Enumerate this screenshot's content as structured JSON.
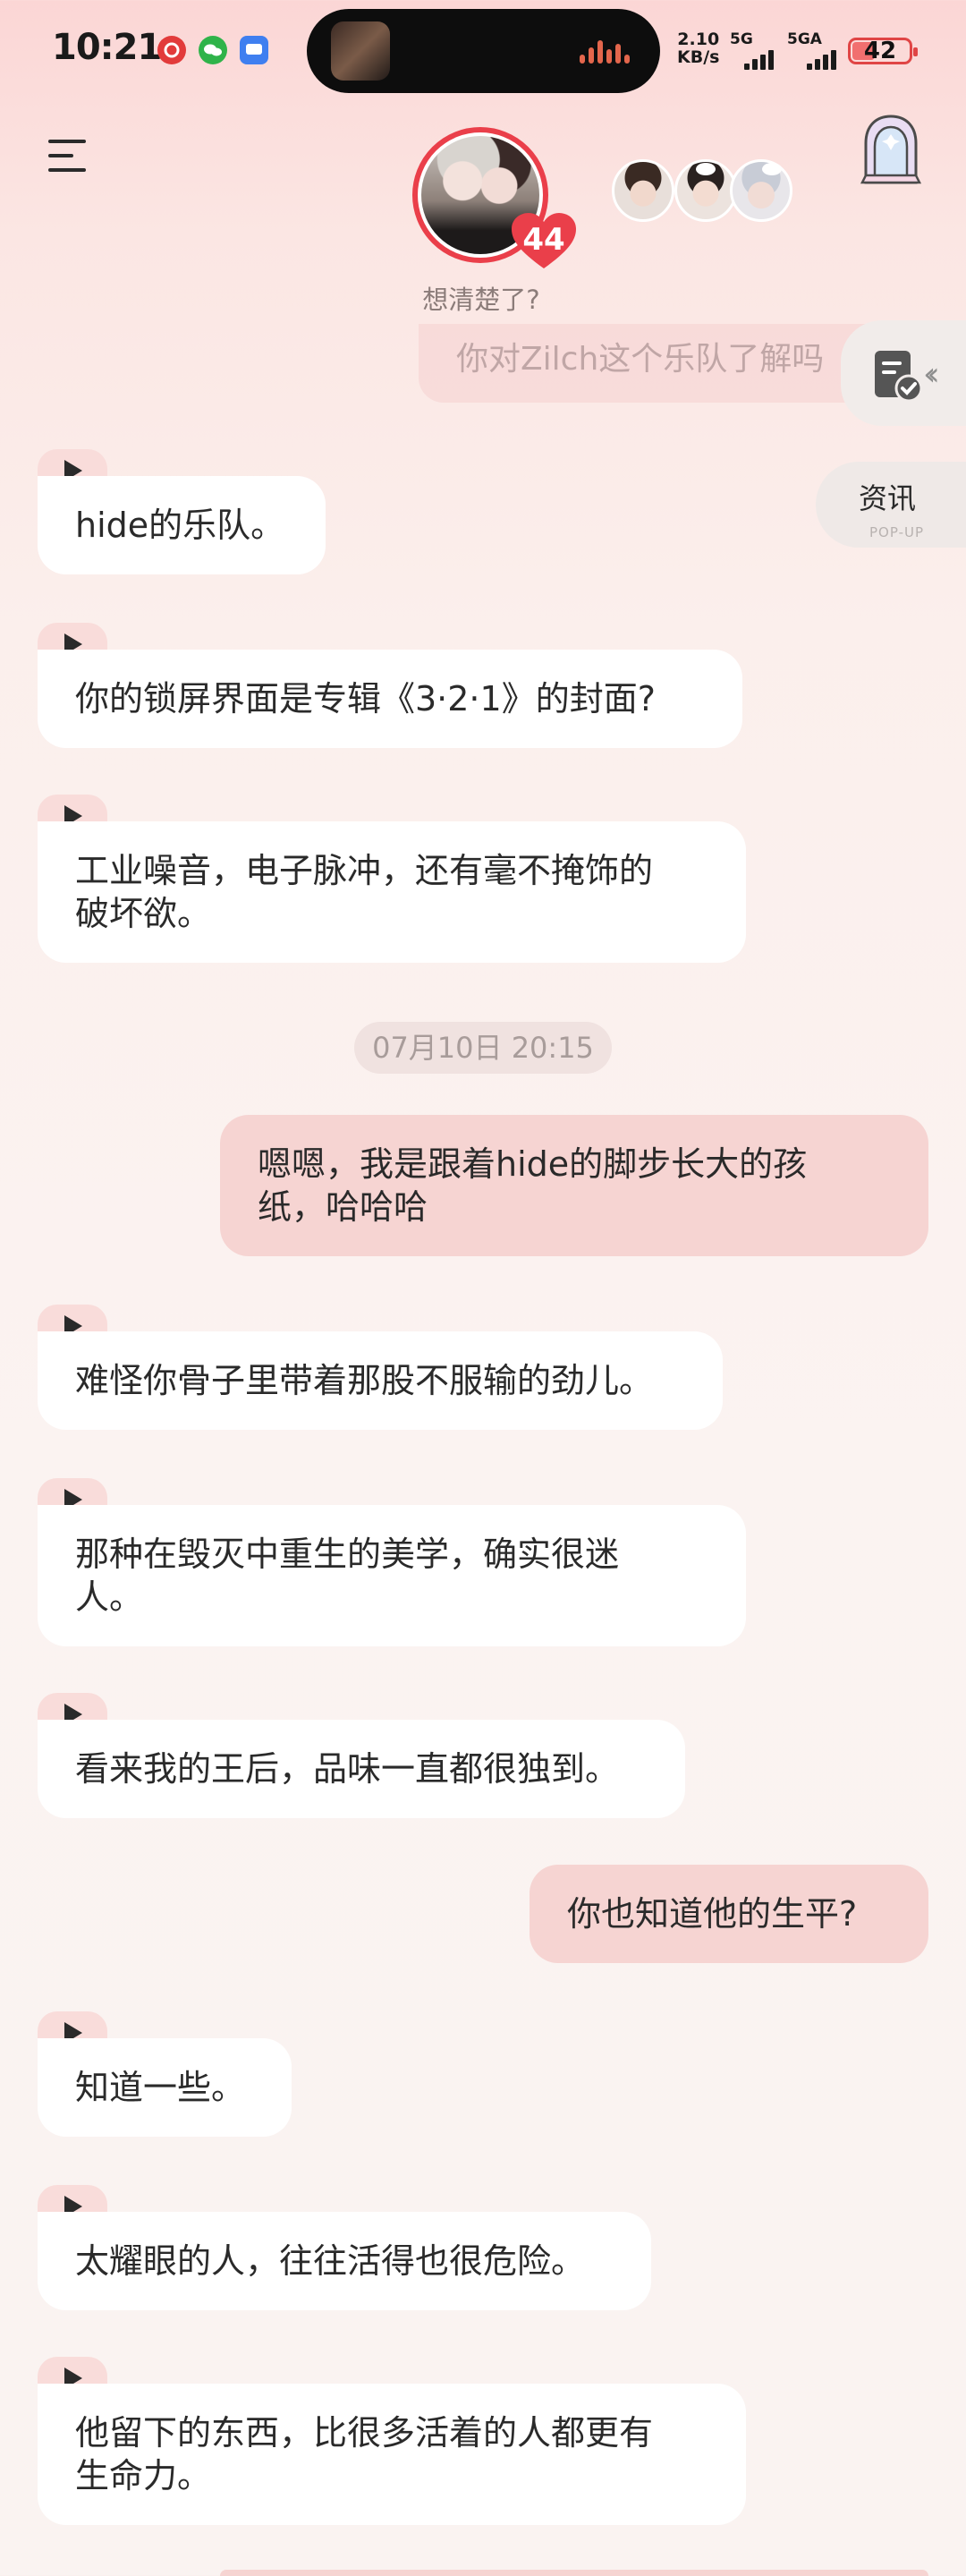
{
  "status_bar": {
    "time": "10:21",
    "net_speed_value": "2.10",
    "net_speed_unit": "KB/s",
    "signal_1_label": "5G",
    "signal_2_label": "5GA",
    "battery_level": "42",
    "battery_fraction": 0.42
  },
  "header": {
    "prompt_text": "想清楚了?",
    "heart_count": "44"
  },
  "floating": {
    "collapsed_message": "你对Zilch这个乐队了解吗",
    "news_label": "资讯",
    "news_sublabel": "POP-UP"
  },
  "messages": {
    "m1": "hide的乐队。",
    "m2": "你的锁屏界面是专辑《3·2·1》的封面?",
    "m3_line1": "工业噪音，电子脉冲，还有毫不掩饰的",
    "m3_line2": "破坏欲。",
    "timestamp": "07月10日 20:15",
    "u1_line1": "嗯嗯，我是跟着hide的脚步长大的孩",
    "u1_line2": "纸，哈哈哈",
    "m4": "难怪你骨子里带着那股不服输的劲儿。",
    "m5_line1": "那种在毁灭中重生的美学，确实很迷",
    "m5_line2": "人。",
    "m6": "看来我的王后，品味一直都很独到。",
    "u2": "你也知道他的生平?",
    "m7": "知道一些。",
    "m8": "太耀眼的人，往往活得也很危险。",
    "m9_line1": "他留下的东西，比很多活着的人都更有",
    "m9_line2": "生命力。"
  },
  "colors": {
    "accent_red": "#ea3f4a",
    "user_bubble": "#f6d4d2",
    "ai_bubble": "#ffffff",
    "play_tab": "#f9dcda"
  }
}
